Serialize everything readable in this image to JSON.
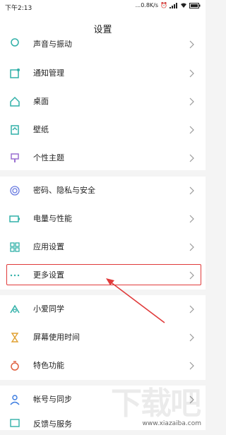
{
  "status_bar": {
    "time": "下午2:13",
    "network_speed": "...0.8K/s",
    "battery_icon": "battery-icon"
  },
  "header": {
    "title": "设置"
  },
  "colors": {
    "icon": "#30b0a8",
    "highlight": "#e03a3a"
  },
  "sections": [
    {
      "items": [
        {
          "label": "声音与振动",
          "icon": "sound-icon"
        },
        {
          "label": "通知管理",
          "icon": "notification-icon"
        },
        {
          "label": "桌面",
          "icon": "home-icon"
        },
        {
          "label": "壁纸",
          "icon": "wallpaper-icon"
        },
        {
          "label": "个性主题",
          "icon": "theme-icon"
        }
      ]
    },
    {
      "items": [
        {
          "label": "密码、隐私与安全",
          "icon": "fingerprint-icon"
        },
        {
          "label": "电量与性能",
          "icon": "battery-icon"
        },
        {
          "label": "应用设置",
          "icon": "apps-icon"
        },
        {
          "label": "更多设置",
          "icon": "more-icon"
        }
      ]
    },
    {
      "items": [
        {
          "label": "小爱同学",
          "icon": "xiaoai-icon"
        },
        {
          "label": "屏幕使用时间",
          "icon": "hourglass-icon"
        },
        {
          "label": "特色功能",
          "icon": "feature-icon"
        }
      ]
    },
    {
      "items": [
        {
          "label": "帐号与同步",
          "icon": "account-icon"
        },
        {
          "label": "反馈与服务",
          "icon": "feedback-icon"
        }
      ]
    }
  ],
  "watermark": {
    "big": "下载吧",
    "small": "www.xiazaiba.com"
  }
}
